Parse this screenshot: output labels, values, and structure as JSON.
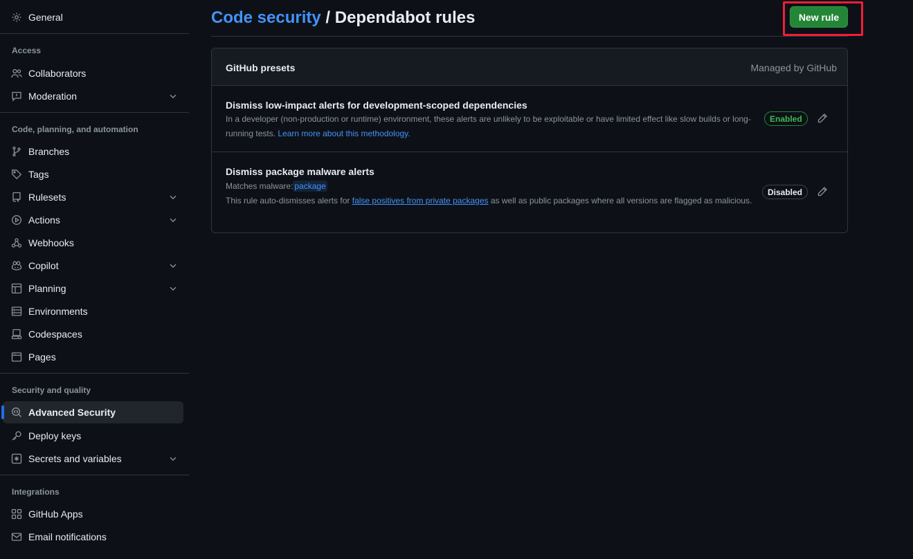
{
  "page": {
    "breadcrumb_link": "Code security",
    "breadcrumb_sep": " / ",
    "title": "Dependabot rules",
    "new_rule_label": "New rule"
  },
  "sidebar": {
    "general": "General",
    "sections": {
      "access": "Access",
      "code": "Code, planning, and automation",
      "security": "Security and quality",
      "integrations": "Integrations"
    },
    "items": {
      "collaborators": "Collaborators",
      "moderation": "Moderation",
      "branches": "Branches",
      "tags": "Tags",
      "rulesets": "Rulesets",
      "actions": "Actions",
      "webhooks": "Webhooks",
      "copilot": "Copilot",
      "planning": "Planning",
      "environments": "Environments",
      "codespaces": "Codespaces",
      "pages": "Pages",
      "advanced_security": "Advanced Security",
      "deploy_keys": "Deploy keys",
      "secrets": "Secrets and variables",
      "github_apps": "GitHub Apps",
      "email_notifications": "Email notifications"
    }
  },
  "presets": {
    "header": "GitHub presets",
    "managed": "Managed by GitHub",
    "rules": [
      {
        "title": "Dismiss low-impact alerts for development-scoped dependencies",
        "desc": "In a developer (non-production or runtime) environment, these alerts are unlikely to be exploitable or have limited effect like slow builds or long-running tests.",
        "link": "Learn more about this methodology.",
        "status": "Enabled"
      },
      {
        "title": "Dismiss package malware alerts",
        "matches_prefix": "Matches malware:",
        "matches_value": "package",
        "desc_before": "This rule auto-dismisses alerts for",
        "link": "false positives from private packages",
        "desc_after": "as well as public packages where all versions are flagged as malicious.",
        "status": "Disabled"
      }
    ]
  },
  "colors": {
    "accent_link": "#4493f8",
    "primary_button": "#238636",
    "highlight_outline": "#f21e38"
  }
}
